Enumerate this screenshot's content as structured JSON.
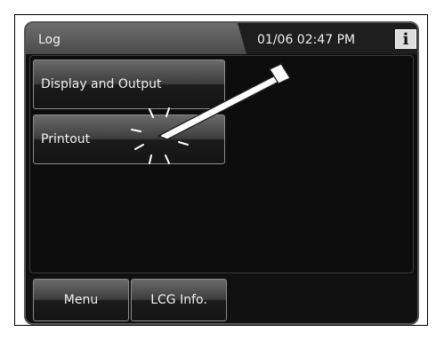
{
  "header": {
    "title": "Log",
    "datetime": "01/06 02:47 PM",
    "info_icon": "i"
  },
  "main": {
    "buttons": [
      {
        "label": "Display and Output"
      },
      {
        "label": "Printout"
      }
    ]
  },
  "footer": {
    "buttons": [
      {
        "label": "Menu"
      },
      {
        "label": "LCG Info."
      }
    ]
  },
  "icons": {
    "stylus": "stylus-icon",
    "tap_indicator": "tap-burst-icon"
  },
  "colors": {
    "background": "#0e0e0e",
    "header_tab": "#5a5a5a",
    "text": "#f0f0f0",
    "info_button": "#dcdcdc"
  }
}
